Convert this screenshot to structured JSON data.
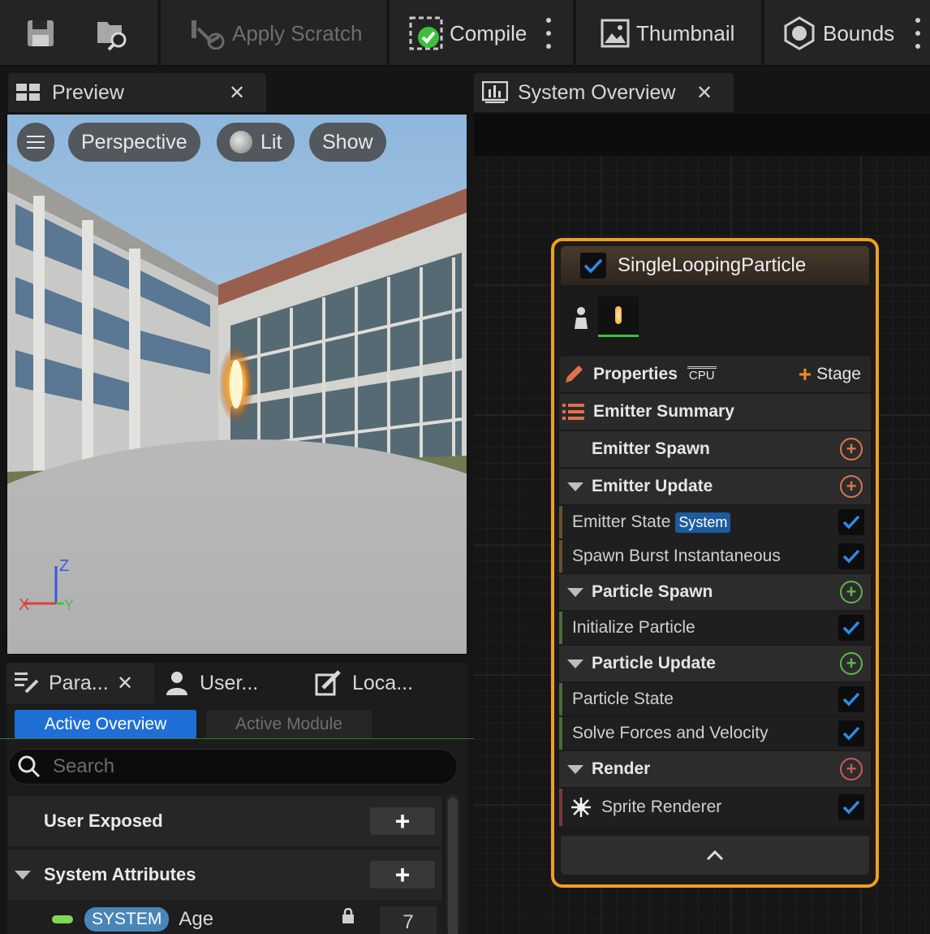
{
  "toolbar": {
    "apply_scratch": "Apply Scratch",
    "compile": "Compile",
    "thumbnail": "Thumbnail",
    "bounds": "Bounds"
  },
  "preview": {
    "tab_label": "Preview",
    "viewport_pills": {
      "menu": "",
      "perspective": "Perspective",
      "lit": "Lit",
      "show": "Show"
    },
    "axis": {
      "z": "Z",
      "y": "Y",
      "x": "X"
    }
  },
  "params": {
    "tabs": [
      "Para...",
      "User...",
      "Loca..."
    ],
    "segments": {
      "active": "Active Overview",
      "inactive": "Active Module"
    },
    "search_placeholder": "Search",
    "sections": {
      "user_exposed": "User Exposed",
      "system_attributes": "System Attributes"
    },
    "age_row": {
      "badge": "SYSTEM",
      "label": "Age",
      "value": "7"
    }
  },
  "overview": {
    "tab_label": "System Overview",
    "node": {
      "title": "SingleLoopingParticle",
      "properties_label": "Properties",
      "cpu_label": "CPU",
      "stage_label": "Stage",
      "emitter_summary": "Emitter Summary",
      "rows": [
        {
          "type": "group",
          "label": "Emitter Spawn",
          "collapsible": false,
          "add_color": "#d8784a"
        },
        {
          "type": "group",
          "label": "Emitter Update",
          "collapsible": true,
          "add_color": "#d8784a"
        },
        {
          "type": "item",
          "label": "Emitter State",
          "badge": "System",
          "accent": "orange"
        },
        {
          "type": "item",
          "label": "Spawn Burst Instantaneous",
          "accent": "orange"
        },
        {
          "type": "group",
          "label": "Particle Spawn",
          "collapsible": true,
          "add_color": "#5fb54a"
        },
        {
          "type": "item",
          "label": "Initialize Particle",
          "accent": "green"
        },
        {
          "type": "group",
          "label": "Particle Update",
          "collapsible": true,
          "add_color": "#5fb54a"
        },
        {
          "type": "item",
          "label": "Particle State",
          "accent": "green"
        },
        {
          "type": "item",
          "label": "Solve Forces and Velocity",
          "accent": "green"
        },
        {
          "type": "group",
          "label": "Render",
          "collapsible": true,
          "add_color": "#c85a5a"
        },
        {
          "type": "item",
          "label": "Sprite Renderer",
          "accent": "red",
          "icon": "sprite"
        }
      ]
    }
  },
  "colors": {
    "accent_orange": "#f0a021",
    "selected_blue": "#1f6fd6",
    "check_blue": "#2f8be8"
  }
}
